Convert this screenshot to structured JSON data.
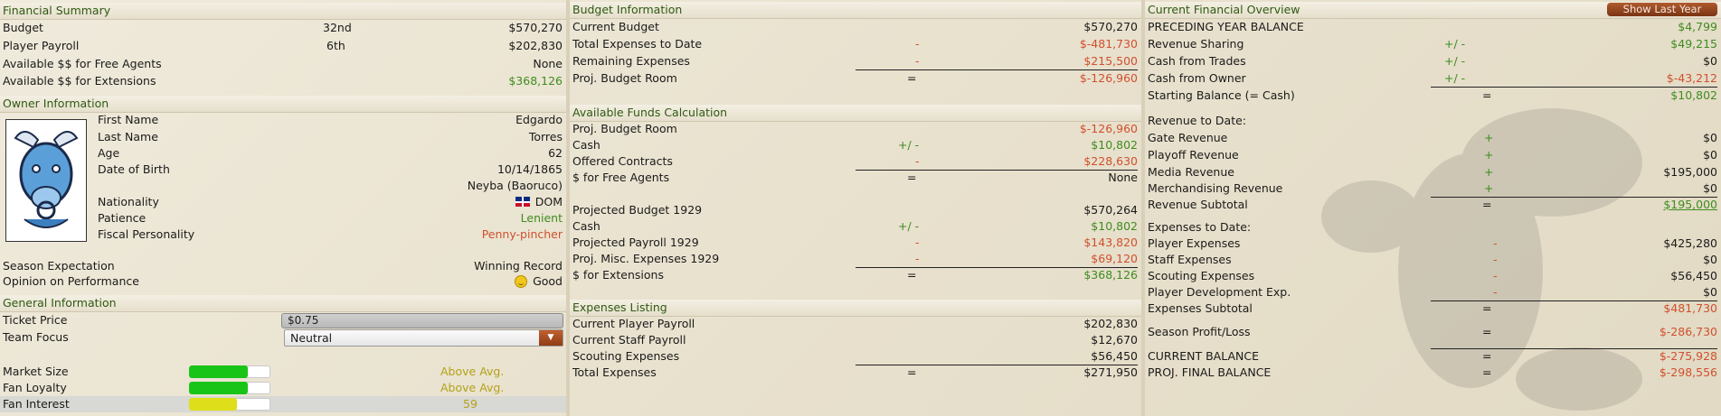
{
  "financial_summary": {
    "title": "Financial Summary",
    "rows": [
      {
        "label": "Budget",
        "rank": "32nd",
        "value": "$570,270"
      },
      {
        "label": "Player Payroll",
        "rank": "6th",
        "value": "$202,830"
      },
      {
        "label": "Available $$ for Free Agents",
        "rank": "",
        "value": "None"
      },
      {
        "label": "Available $$ for Extensions",
        "rank": "",
        "value": "$368,126"
      }
    ]
  },
  "owner": {
    "title": "Owner Information",
    "logo": "bull-team-logo",
    "rows": [
      {
        "label": "First Name",
        "value": "Edgardo"
      },
      {
        "label": "Last Name",
        "value": "Torres"
      },
      {
        "label": "Age",
        "value": "62"
      },
      {
        "label": "Date of Birth",
        "value": "10/14/1865"
      },
      {
        "label": "",
        "value": "Neyba (Baoruco)"
      },
      {
        "label": "Nationality",
        "value": "DOM"
      },
      {
        "label": "Patience",
        "value": "Lenient"
      },
      {
        "label": "Fiscal Personality",
        "value": "Penny-pincher"
      }
    ],
    "season_expectation_label": "Season Expectation",
    "season_expectation": "Winning Record",
    "opinion_label": "Opinion on Performance",
    "opinion": "Good",
    "opinion_icon": "smiley-face-icon",
    "nationality_flag": "dominican-republic-flag-icon"
  },
  "general": {
    "title": "General Information",
    "ticket_label": "Ticket Price",
    "ticket_value": "$0.75",
    "focus_label": "Team Focus",
    "focus_value": "Neutral",
    "market_label": "Market Size",
    "market_value": "Above Avg.",
    "market_level": 0.72,
    "loyalty_label": "Fan Loyalty",
    "loyalty_value": "Above Avg.",
    "loyalty_level": 0.72,
    "interest_label": "Fan Interest",
    "interest_value": "59",
    "interest_level": 0.59,
    "colors": {
      "bar_green": "#19c419",
      "bar_yellow": "#dede1a"
    }
  },
  "budget": {
    "title": "Budget Information",
    "rows": [
      {
        "label": "Current Budget",
        "op": "",
        "value": "$570,270"
      },
      {
        "label": "Total Expenses to Date",
        "op": "-",
        "value": "$-481,730"
      },
      {
        "label": "Remaining Expenses",
        "op": "-",
        "value": "$215,500"
      },
      {
        "label": "Proj. Budget Room",
        "op": "=",
        "value": "$-126,960"
      }
    ]
  },
  "funds": {
    "title": "Available Funds Calculation",
    "rows": [
      {
        "label": "Proj. Budget Room",
        "op": "",
        "value": "$-126,960"
      },
      {
        "label": "Cash",
        "op": "+/ -",
        "value": "$10,802"
      },
      {
        "label": "Offered Contracts",
        "op": "-",
        "value": "$228,630"
      },
      {
        "label": "$ for Free Agents",
        "op": "=",
        "value": "None"
      },
      {
        "label": "Projected Budget 1929",
        "op": "",
        "value": "$570,264"
      },
      {
        "label": "Cash",
        "op": "+/ -",
        "value": "$10,802"
      },
      {
        "label": "Projected Payroll 1929",
        "op": "-",
        "value": "$143,820"
      },
      {
        "label": "Proj. Misc. Expenses 1929",
        "op": "-",
        "value": "$69,120"
      },
      {
        "label": "$ for Extensions",
        "op": "=",
        "value": "$368,126"
      }
    ]
  },
  "expenses": {
    "title": "Expenses Listing",
    "rows": [
      {
        "label": "Current Player Payroll",
        "op": "",
        "value": "$202,830"
      },
      {
        "label": "Current Staff Payroll",
        "op": "",
        "value": "$12,670"
      },
      {
        "label": "Scouting Expenses",
        "op": "",
        "value": "$56,450"
      },
      {
        "label": "Total Expenses",
        "op": "=",
        "value": "$271,950"
      }
    ]
  },
  "overview": {
    "title": "Current Financial Overview",
    "show_last_year": "Show Last Year",
    "rows": [
      {
        "label": "PRECEDING YEAR BALANCE",
        "op": "",
        "value": "$4,799"
      },
      {
        "label": "Revenue Sharing",
        "op": "+/ -",
        "value": "$49,215"
      },
      {
        "label": "Cash from Trades",
        "op": "+/ -",
        "value": "$0"
      },
      {
        "label": "Cash from Owner",
        "op": "+/ -",
        "value": "$-43,212"
      },
      {
        "label": "Starting Balance (= Cash)",
        "op": "=",
        "value": "$10,802"
      },
      {
        "label": "Revenue to Date:",
        "op": "",
        "value": ""
      },
      {
        "label": "Gate Revenue",
        "op": "+",
        "value": "$0"
      },
      {
        "label": "Playoff Revenue",
        "op": "+",
        "value": "$0"
      },
      {
        "label": "Media Revenue",
        "op": "+",
        "value": "$195,000"
      },
      {
        "label": "Merchandising Revenue",
        "op": "+",
        "value": "$0"
      },
      {
        "label": "Revenue Subtotal",
        "op": "=",
        "value": "$195,000"
      },
      {
        "label": "Expenses to Date:",
        "op": "",
        "value": ""
      },
      {
        "label": "Player Expenses",
        "op": "-",
        "value": "$425,280"
      },
      {
        "label": "Staff Expenses",
        "op": "-",
        "value": "$0"
      },
      {
        "label": "Scouting Expenses",
        "op": "-",
        "value": "$56,450"
      },
      {
        "label": "Player Development Exp.",
        "op": "-",
        "value": "$0"
      },
      {
        "label": "Expenses Subtotal",
        "op": "=",
        "value": "$481,730"
      },
      {
        "label": "Season Profit/Loss",
        "op": "=",
        "value": "$-286,730"
      },
      {
        "label": "CURRENT BALANCE",
        "op": "=",
        "value": "$-275,928"
      },
      {
        "label": "PROJ. FINAL BALANCE",
        "op": "=",
        "value": "$-298,556"
      }
    ]
  }
}
